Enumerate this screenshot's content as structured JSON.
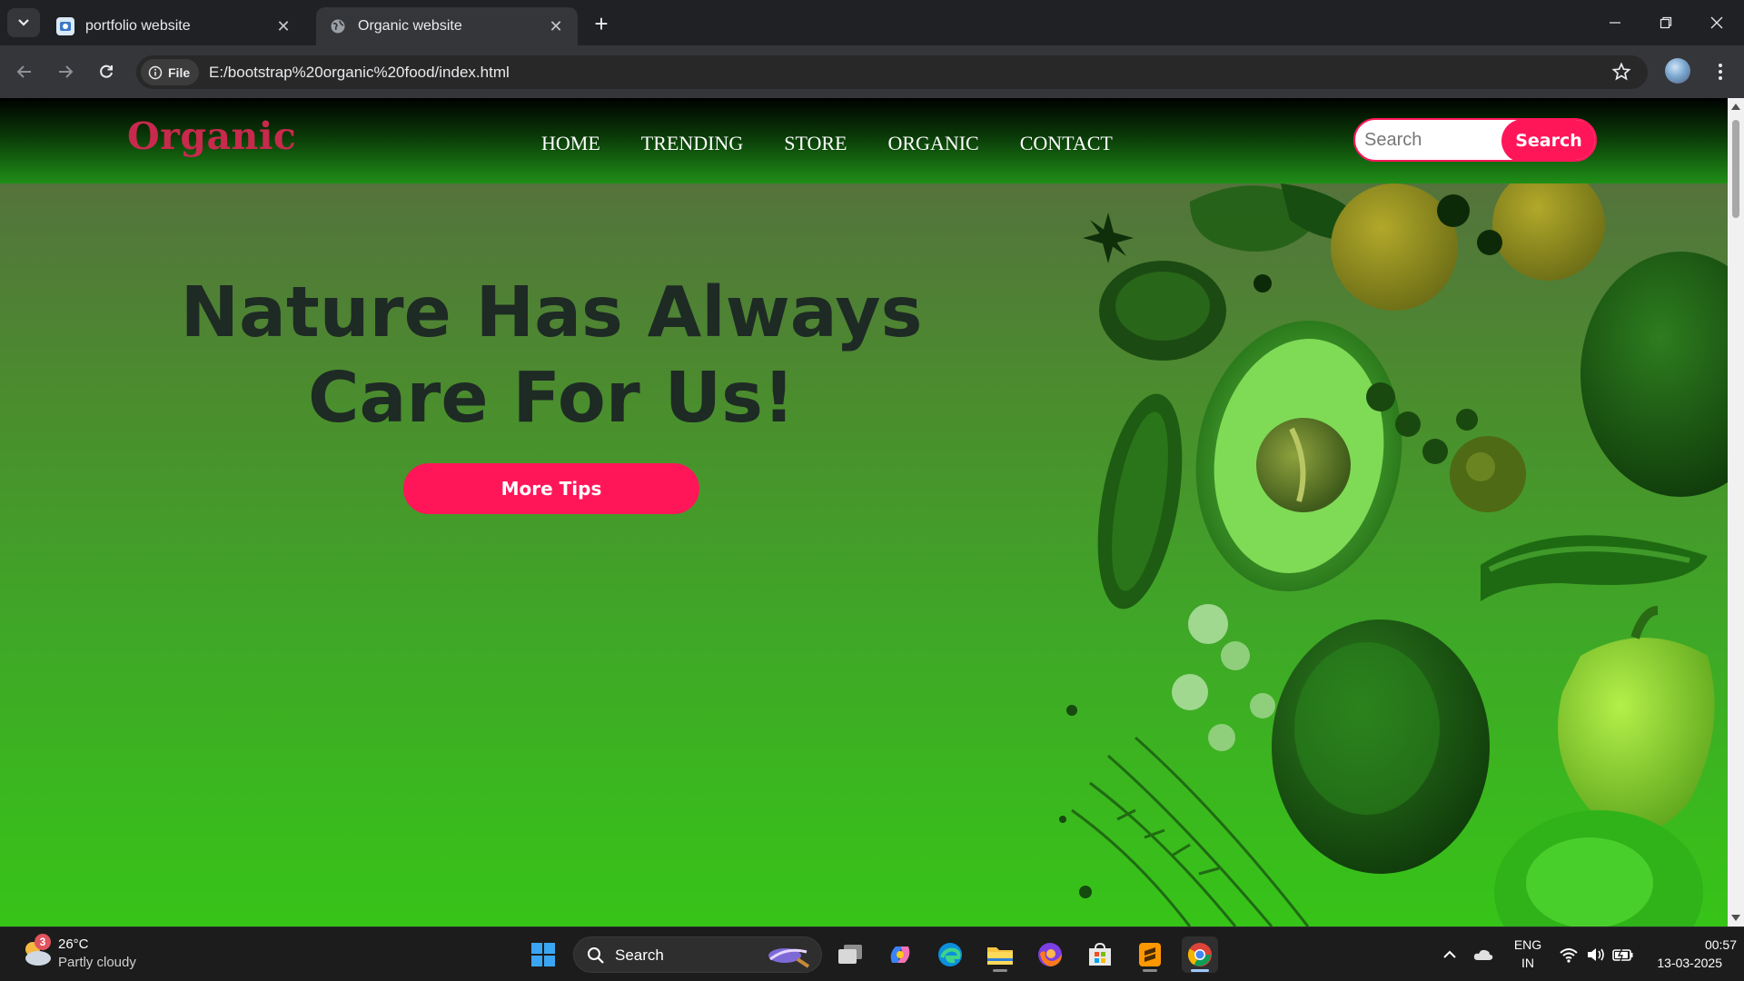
{
  "browser": {
    "tabs": [
      {
        "title": "portfolio website",
        "favicon": "portfolio-favicon-icon",
        "active": false
      },
      {
        "title": "Organic website",
        "favicon": "globe-icon",
        "active": true
      }
    ],
    "address": {
      "scheme_label": "File",
      "url": "E:/bootstrap%20organic%20food/index.html"
    }
  },
  "site": {
    "brand": "Organic",
    "nav": [
      "HOME",
      "TRENDING",
      "STORE",
      "ORGANIC",
      "CONTACT"
    ],
    "search": {
      "placeholder": "Search",
      "button": "Search"
    },
    "hero": {
      "title": "Nature Has Always Care For Us!",
      "cta": "More Tips"
    },
    "colors": {
      "accent": "#ff1659",
      "brand": "#c8294d",
      "hero_green": "#3fa727"
    }
  },
  "taskbar": {
    "weather": {
      "temp": "26°C",
      "desc": "Partly cloudy",
      "badge": "3"
    },
    "search_label": "Search",
    "apps": [
      "windows-start-icon",
      "task-view-icon",
      "copilot-icon",
      "edge-icon",
      "file-explorer-icon",
      "firefox-icon",
      "microsoft-store-icon",
      "sublime-text-icon",
      "chrome-icon"
    ],
    "tray": {
      "lang": "ENG",
      "region": "IN",
      "time": "00:57",
      "date": "13-03-2025"
    }
  }
}
